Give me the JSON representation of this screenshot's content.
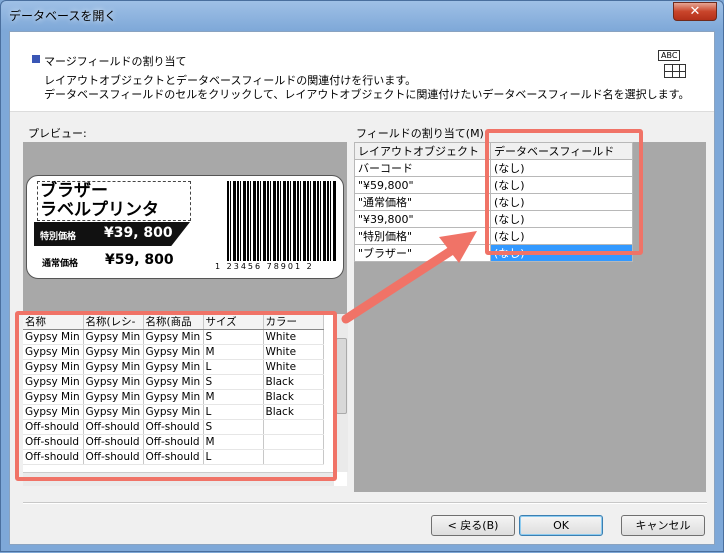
{
  "window": {
    "title": "データベースを開く",
    "close_glyph": "✕"
  },
  "header": {
    "section_title": "マージフィールドの割り当て",
    "desc1": "レイアウトオブジェクトとデータベースフィールドの関連付けを行います。",
    "desc2": "データベースフィールドのセルをクリックして、レイアウトオブジェクトに関連付けたいデータベースフィールド名を選択します。",
    "icon_text": "ABC"
  },
  "preview": {
    "label": "プレビュー:",
    "card": {
      "name_line1": "ブラザー",
      "name_line2": "ラベルプリンタ",
      "special_label": "特別価格",
      "special_price": "¥39, 800",
      "normal_label": "通常価格",
      "normal_price": "¥59, 800",
      "barcode_digits": "1 23456 78901 2"
    }
  },
  "data_grid": {
    "columns": [
      "名称",
      "名称(レシ-",
      "名称(商品",
      "サイズ",
      "カラー"
    ],
    "rows": [
      [
        "Gypsy Min",
        "Gypsy Min",
        "Gypsy Min",
        "S",
        "White"
      ],
      [
        "Gypsy Min",
        "Gypsy Min",
        "Gypsy Min",
        "M",
        "White"
      ],
      [
        "Gypsy Min",
        "Gypsy Min",
        "Gypsy Min",
        "L",
        "White"
      ],
      [
        "Gypsy Min",
        "Gypsy Min",
        "Gypsy Min",
        "S",
        "Black"
      ],
      [
        "Gypsy Min",
        "Gypsy Min",
        "Gypsy Min",
        "M",
        "Black"
      ],
      [
        "Gypsy Min",
        "Gypsy Min",
        "Gypsy Min",
        "L",
        "Black"
      ],
      [
        "Off-should",
        "Off-should",
        "Off-should",
        "S",
        ""
      ],
      [
        "Off-should",
        "Off-should",
        "Off-should",
        "M",
        ""
      ],
      [
        "Off-should",
        "Off-should",
        "Off-should",
        "L",
        ""
      ]
    ]
  },
  "assign": {
    "label": "フィールドの割り当て(M):",
    "col_object": "レイアウトオブジェクト",
    "col_field": "データベースフィールド",
    "rows": [
      {
        "object": "バーコード",
        "field": "(なし)"
      },
      {
        "object": "\"¥59,800\"",
        "field": "(なし)"
      },
      {
        "object": "\"通常価格\"",
        "field": "(なし)"
      },
      {
        "object": "\"¥39,800\"",
        "field": "(なし)"
      },
      {
        "object": "\"特別価格\"",
        "field": "(なし)"
      },
      {
        "object": "\"ブラザー\"",
        "field": "(なし)"
      }
    ],
    "selected_index": 5
  },
  "buttons": {
    "back": "< 戻る(B)",
    "ok": "OK",
    "cancel": "キャンセル"
  },
  "colors": {
    "highlight": "#f07367",
    "selection": "#3399ff",
    "title_bar": "#7ea8d8"
  }
}
